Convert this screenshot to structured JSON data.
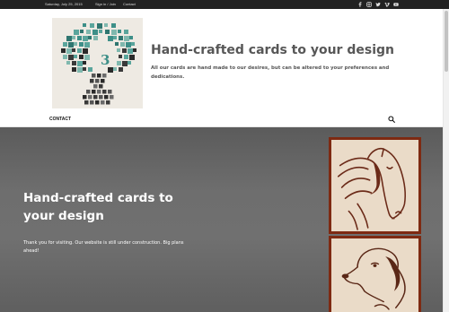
{
  "topbar": {
    "date": "Saturday, July 25, 2015",
    "signin_label": "Sign in / Join",
    "contact_label": "Contact",
    "social_icons": [
      "facebook-icon",
      "instagram-icon",
      "twitter-icon",
      "vimeo-icon",
      "youtube-icon"
    ]
  },
  "header": {
    "logo_number": "3",
    "site_title": "Hand-crafted cards to your design",
    "site_description": "All our cards are hand made to our desires, but can be altered to your preferences and dedications."
  },
  "menu": {
    "items": [
      "CONTACT"
    ],
    "search_icon": "search-icon"
  },
  "hero": {
    "title": "Hand-crafted cards to your design",
    "text": "Thank you for visiting. Our website is still under construction. Big plans ahead!",
    "card_images": [
      "horse-card",
      "dog-card"
    ]
  },
  "colors": {
    "topbar_bg": "#222222",
    "title_gray": "#575757",
    "card_frame": "#7e2a12",
    "card_paper": "#eadbc8",
    "logo_accent": "#3d8f88"
  }
}
